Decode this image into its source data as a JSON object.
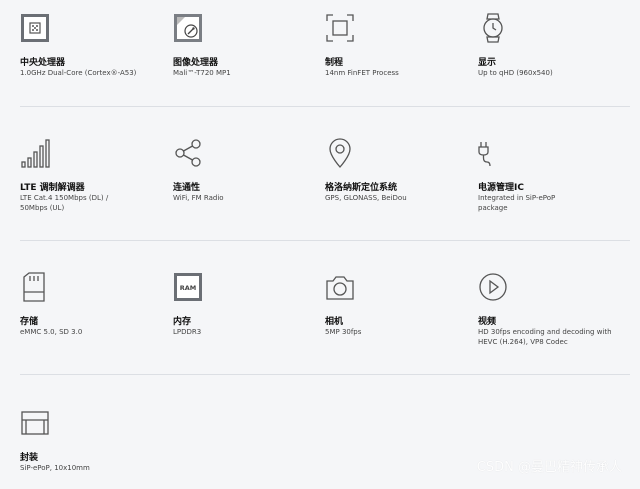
{
  "features": [
    {
      "name": "cpu-icon",
      "title": "中央处理器",
      "desc": "1.0GHz Dual-Core (Cortex®-A53)"
    },
    {
      "name": "gpu-icon",
      "title": "图像处理器",
      "desc": "Mali™-T720 MP1"
    },
    {
      "name": "process-icon",
      "title": "制程",
      "desc": "14nm FinFET Process"
    },
    {
      "name": "watch-icon",
      "title": "显示",
      "desc": "Up to qHD (960x540)"
    },
    {
      "name": "signal-bars-icon",
      "title": "LTE 调制解调器",
      "desc": "LTE Cat.4 150Mbps (DL) / 50Mbps (UL)"
    },
    {
      "name": "share-icon",
      "title": "连通性",
      "desc": "WiFi, FM Radio"
    },
    {
      "name": "location-pin-icon",
      "title": "格洛纳斯定位系统",
      "desc": "GPS, GLONASS, BeiDou"
    },
    {
      "name": "plug-icon",
      "title": "电源管理IC",
      "desc": "Integrated in SiP-ePoP package"
    },
    {
      "name": "sd-card-icon",
      "title": "存储",
      "desc": "eMMC 5.0, SD 3.0"
    },
    {
      "name": "ram-chip-icon",
      "title": "内存",
      "desc": "LPDDR3"
    },
    {
      "name": "camera-icon",
      "title": "相机",
      "desc": "5MP 30fps"
    },
    {
      "name": "play-icon",
      "title": "视频",
      "desc": "HD 30fps encoding and decoding with HEVC (H.264), VP8 Codec"
    },
    {
      "name": "package-icon",
      "title": "封装",
      "desc": "SiP-ePoP, 10x10mm"
    }
  ],
  "ram_label": "RAM",
  "watermark": "CSDN @曼巴精神传承人"
}
